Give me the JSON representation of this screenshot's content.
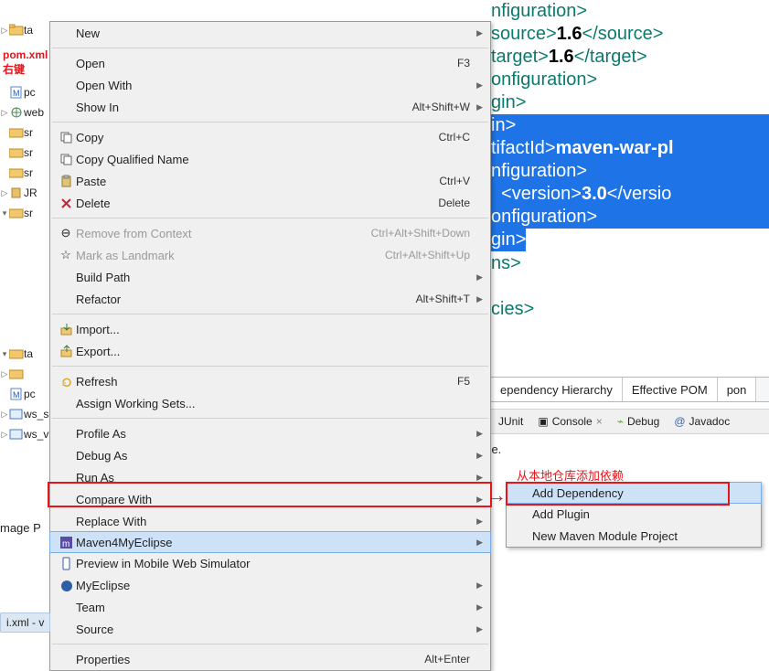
{
  "annotations": {
    "pom_right_click": "pom.xml右键",
    "submenu_note": "从本地仓库添加依赖"
  },
  "tree": {
    "items": [
      "ta",
      "pc",
      "web",
      "sr",
      "sr",
      "sr",
      "JR",
      "sr",
      "",
      "",
      "",
      "",
      "ta",
      "",
      "pc",
      "ws_s",
      "ws_v"
    ]
  },
  "ctx": {
    "new": "New",
    "open": "Open",
    "open_kb": "F3",
    "open_with": "Open With",
    "show_in": "Show In",
    "show_in_kb": "Alt+Shift+W",
    "copy": "Copy",
    "copy_kb": "Ctrl+C",
    "copy_qn": "Copy Qualified Name",
    "paste": "Paste",
    "paste_kb": "Ctrl+V",
    "delete": "Delete",
    "delete_kb": "Delete",
    "remove_ctx": "Remove from Context",
    "remove_ctx_kb": "Ctrl+Alt+Shift+Down",
    "mark_lm": "Mark as Landmark",
    "mark_lm_kb": "Ctrl+Alt+Shift+Up",
    "build_path": "Build Path",
    "refactor": "Refactor",
    "refactor_kb": "Alt+Shift+T",
    "import": "Import...",
    "export": "Export...",
    "refresh": "Refresh",
    "refresh_kb": "F5",
    "assign_ws": "Assign Working Sets...",
    "profile_as": "Profile As",
    "debug_as": "Debug As",
    "run_as": "Run As",
    "compare": "Compare With",
    "replace": "Replace With",
    "maven4": "Maven4MyEclipse",
    "preview": "Preview in Mobile Web Simulator",
    "myeclipse": "MyEclipse",
    "team": "Team",
    "source": "Source",
    "props": "Properties",
    "props_kb": "Alt+Enter"
  },
  "submenu": {
    "add_dep": "Add Dependency",
    "add_plugin": "Add Plugin",
    "new_module": "New Maven Module Project"
  },
  "editor": {
    "l1_a": "nfiguration>",
    "l2_a": "source>",
    "l2_t": "1.6",
    "l2_b": "</source>",
    "l3_a": "target>",
    "l3_t": "1.6",
    "l3_b": "</target>",
    "l4": "onfiguration>",
    "l5": "gin>",
    "l6": "in>",
    "l7_a": "tifactId>",
    "l7_t": "maven-war-pl",
    "l8": "nfiguration>",
    "l9_a": "  <version>",
    "l9_t": "3.0",
    "l9_b": "</versio",
    "l10": "onfiguration>",
    "l11": "gin>",
    "l12": "ns>",
    "l13": "cies>"
  },
  "ed_tabs": {
    "dep_h": "ependency Hierarchy",
    "eff_pom": "Effective POM",
    "pom": "pon"
  },
  "views": {
    "junit": "JUnit",
    "console": "Console",
    "debug": "Debug",
    "javadoc": "Javadoc"
  },
  "status_text": "s time.",
  "image_pkg": "mage P",
  "status_bar": "i.xml - v"
}
